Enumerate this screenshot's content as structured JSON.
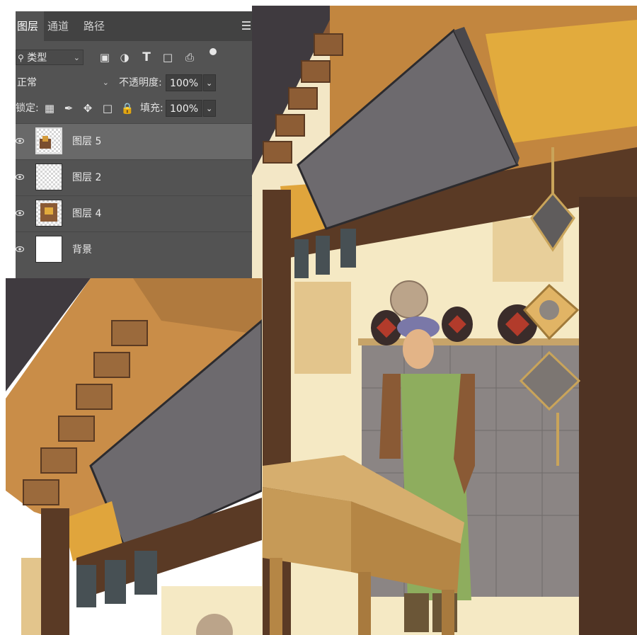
{
  "layers_panel": {
    "tabs": [
      {
        "label": "图层",
        "active": true
      },
      {
        "label": "通道",
        "active": false
      },
      {
        "label": "路径",
        "active": false
      }
    ],
    "filter": {
      "label": "类型"
    },
    "blend_mode": "正常",
    "opacity": {
      "label": "不透明度:",
      "value": "100%"
    },
    "lock": {
      "label": "锁定:"
    },
    "fill": {
      "label": "填充:",
      "value": "100%"
    },
    "layers": [
      {
        "name": "图层 5",
        "selected": true
      },
      {
        "name": "图层 2",
        "selected": false
      },
      {
        "name": "图层 4",
        "selected": false
      },
      {
        "name": "背景",
        "selected": false
      }
    ]
  },
  "colors": {
    "panel_bg": "#535353",
    "tab_bar": "#424242",
    "selected_layer": "#696969",
    "wood_beam": "#5a3a25",
    "signboard": "#6d6a6e",
    "gold": "#d9a43a"
  }
}
